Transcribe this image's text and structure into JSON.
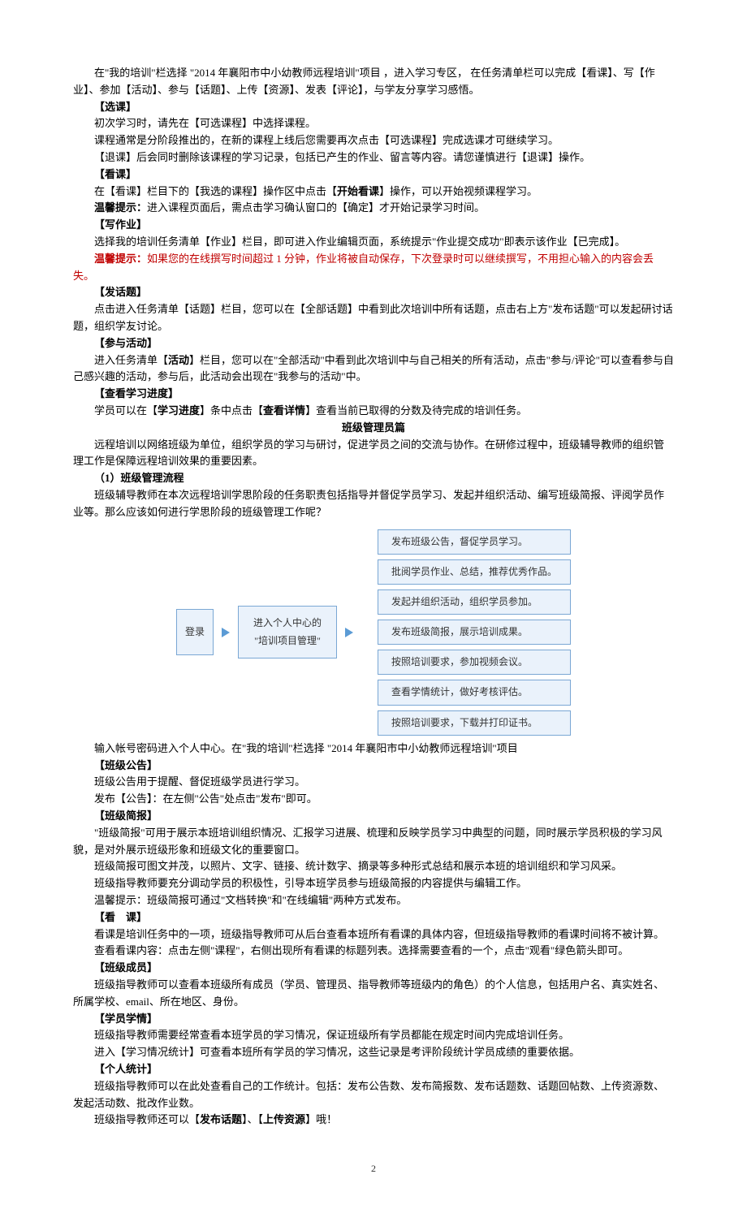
{
  "intro1_a": "在\"我的培训\"栏选择 \"2014 年襄阳市中小幼教师远程培训\"项目 ，进入学习专区， 在任务清单栏可以完成【看课】、写【作业】、参加【活动】、参与【话题】、上传【资源】、发表【评论】，与学友分享学习感悟。",
  "sec1_title": "【选课】",
  "sec1_l1": "初次学习时，请先在【可选课程】中选择课程。",
  "sec1_l2": "课程通常是分阶段推出的，在新的课程上线后您需要再次点击【可选课程】完成选课才可继续学习。",
  "sec1_l3": "【退课】后会同时删除该课程的学习记录，包括已产生的作业、留言等内容。请您谨慎进行【退课】操作。",
  "sec2_title": "【看课】",
  "sec2_l1_a": "在【看课】栏目下的【我选的课程】操作区中点击【",
  "sec2_l1_b": "开始看课",
  "sec2_l1_c": "】操作，可以开始视频课程学习。",
  "sec2_l2_label": "温馨提示：",
  "sec2_l2": "进入课程页面后，需点击学习确认窗口的【确定】才开始记录学习时间。",
  "sec3_title": "【写作业】",
  "sec3_l1": "选择我的培训任务清单【作业】栏目，即可进入作业编辑页面，系统提示\"作业提交成功\"即表示该作业【已完成】。",
  "sec3_l2_label": "温馨提示：",
  "sec3_l2": "如果您的在线撰写时间超过 1 分钟，作业将被自动保存，下次登录时可以继续撰写，不用担心输入的内容会丢失。",
  "sec4_title": "【发话题】",
  "sec4_l1": "点击进入任务清单【话题】栏目，您可以在【全部话题】中看到此次培训中所有话题，点击右上方\"发布话题\"可以发起研讨话题，组织学友讨论。",
  "sec5_title": "【参与活动】",
  "sec5_l1_a": "进入任务清单【",
  "sec5_l1_b": "活动",
  "sec5_l1_c": "】栏目，您可以在\"全部活动\"中看到此次培训中与自己相关的所有活动，点击\"参与/评论\"可以查看参与自己感兴趣的活动，参与后，此活动会出现在\"我参与的活动\"中。",
  "sec6_title": "【查看学习进度】",
  "sec6_l1_a": "学员可以在【",
  "sec6_l1_b": "学习进度",
  "sec6_l1_c": "】条中点击【",
  "sec6_l1_d": "查看详情",
  "sec6_l1_e": "】查看当前已取得的分数及待完成的培训任务。",
  "part_title": "班级管理员篇",
  "part_l1": "远程培训以网络班级为单位，组织学员的学习与研讨，促进学员之间的交流与协作。在研修过程中，班级辅导教师的组织管理工作是保障远程培训效果的重要因素。",
  "mgmt_title": "（1）班级管理流程",
  "mgmt_l1": "班级辅导教师在本次远程培训学思阶段的任务职责包括指导并督促学员学习、发起并组织活动、编写班级简报、评阅学员作业等。那么应该如何进行学思阶段的班级管理工作呢？",
  "diagram": {
    "login": "登录",
    "center_l1": "进入个人中心的",
    "center_l2": "\"培训项目管理\"",
    "tasks": [
      "发布班级公告，督促学员学习。",
      "批阅学员作业、总结，推荐优秀作品。",
      "发起并组织活动，组织学员参加。",
      "发布班级简报，展示培训成果。",
      "按照培训要求，参加视频会议。",
      "查看学情统计，做好考核评估。",
      "按照培训要求，下载并打印证书。"
    ]
  },
  "after_diag": "输入帐号密码进入个人中心。在\"我的培训\"栏选择 \"2014 年襄阳市中小幼教师远程培训\"项目",
  "cls1_title": "【班级公告】",
  "cls1_l1": "班级公告用于提醒、督促班级学员进行学习。",
  "cls1_l2": "发布【公告】：在左侧\"公告\"处点击\"发布\"即可。",
  "cls2_title": "【班级简报】",
  "cls2_l1": "\"班级简报\"可用于展示本班培训组织情况、汇报学习进展、梳理和反映学员学习中典型的问题，同时展示学员积极的学习风貌，是对外展示班级形象和班级文化的重要窗口。",
  "cls2_l2": "班级简报可图文并茂，以照片、文字、链接、统计数字、摘录等多种形式总结和展示本班的培训组织和学习风采。",
  "cls2_l3": "班级指导教师要充分调动学员的积极性，引导本班学员参与班级简报的内容提供与编辑工作。",
  "cls2_l4": "温馨提示：班级简报可通过\"文档转换\"和\"在线编辑\"两种方式发布。",
  "cls3_title": "【看　课】",
  "cls3_l1": "看课是培训任务中的一项，班级指导教师可从后台查看本班所有看课的具体内容，但班级指导教师的看课时间将不被计算。",
  "cls3_l2": "查看看课内容：点击左侧\"课程\"，右侧出现所有看课的标题列表。选择需要查看的一个，点击\"观看\"绿色箭头即可。",
  "cls4_title": "【班级成员】",
  "cls4_l1": "班级指导教师可以查看本班级所有成员（学员、管理员、指导教师等班级内的角色）的个人信息，包括用户名、真实姓名、所属学校、email、所在地区、身份。",
  "cls5_title": "【学员学情】",
  "cls5_l1": "班级指导教师需要经常查看本班学员的学习情况，保证班级所有学员都能在规定时间内完成培训任务。",
  "cls5_l2": "进入【学习情况统计】可查看本班所有学员的学习情况，这些记录是考评阶段统计学员成绩的重要依据。",
  "cls6_title": "【个人统计】",
  "cls6_l1": "班级指导教师可以在此处查看自己的工作统计。包括：发布公告数、发布简报数、发布话题数、话题回帖数、上传资源数、发起活动数、批改作业数。",
  "cls6_l2_a": "班级指导教师还可以【",
  "cls6_l2_b": "发布话题",
  "cls6_l2_c": "】、【",
  "cls6_l2_d": "上传资源",
  "cls6_l2_e": "】哦！",
  "page_num": "2"
}
